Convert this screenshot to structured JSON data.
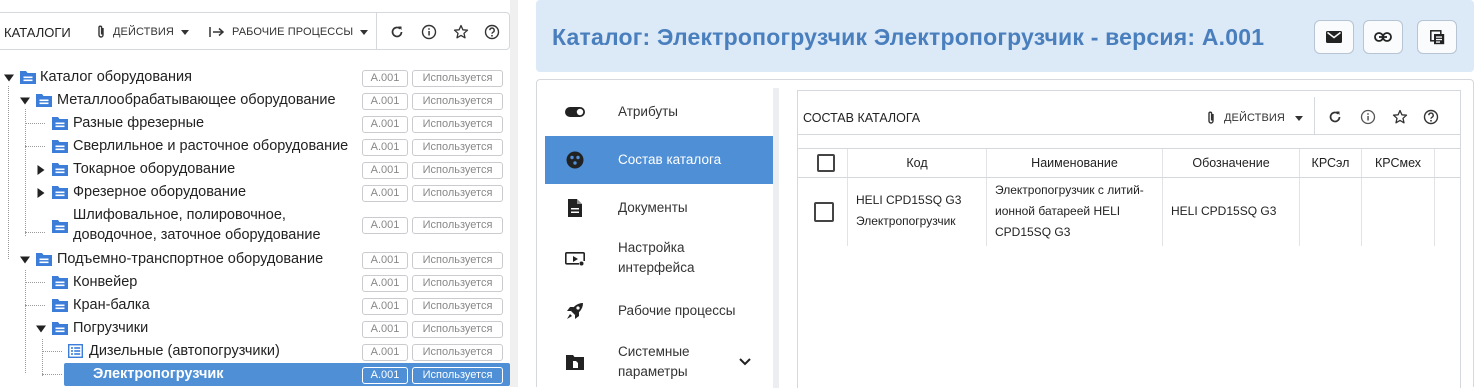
{
  "left_toolbar": {
    "title": "КАТАЛОГИ",
    "actions_label": "ДЕЙСТВИЯ",
    "workflows_label": "РАБОЧИЕ ПРОЦЕССЫ",
    "icons": [
      "paperclip-icon",
      "arrow-right-bar-icon",
      "refresh-icon",
      "info-icon",
      "star-icon",
      "help-icon"
    ]
  },
  "tree": {
    "items": [
      {
        "label": "Каталог оборудования",
        "version": "A.001",
        "status": "Используется",
        "expanded": true,
        "icon": "folder-icon"
      },
      {
        "label": "Металлообрабатывающее оборудование",
        "version": "A.001",
        "status": "Используется",
        "expanded": true,
        "icon": "folder-icon"
      },
      {
        "label": "Разные фрезерные",
        "version": "A.001",
        "status": "Используется",
        "icon": "folder-icon"
      },
      {
        "label": "Сверлильное и расточное оборудование",
        "version": "A.001",
        "status": "Используется",
        "icon": "folder-icon"
      },
      {
        "label": "Токарное оборудование",
        "version": "A.001",
        "status": "Используется",
        "expanded": false,
        "icon": "folder-icon"
      },
      {
        "label": "Фрезерное оборудование",
        "version": "A.001",
        "status": "Используется",
        "expanded": false,
        "icon": "folder-icon"
      },
      {
        "label": "Шлифовальное, полировочное, доводочное, заточное оборудование",
        "version": "A.001",
        "status": "Используется",
        "icon": "folder-icon"
      },
      {
        "label": "Подъемно-транспортное оборудование",
        "version": "A.001",
        "status": "Используется",
        "expanded": true,
        "icon": "folder-icon"
      },
      {
        "label": "Конвейер",
        "version": "A.001",
        "status": "Используется",
        "icon": "folder-icon"
      },
      {
        "label": "Кран-балка",
        "version": "A.001",
        "status": "Используется",
        "icon": "folder-icon"
      },
      {
        "label": "Погрузчики",
        "version": "A.001",
        "status": "Используется",
        "expanded": true,
        "icon": "folder-icon"
      },
      {
        "label": "Дизельные (автопогрузчики)",
        "version": "A.001",
        "status": "Используется",
        "icon": "list-table-icon"
      },
      {
        "label": "Электропогрузчик",
        "version": "A.001",
        "status": "Используется",
        "selected": true
      }
    ]
  },
  "header": {
    "title": "Каталог: Электропогрузчик Электропогрузчик - версия: A.001",
    "buttons": [
      "email-icon",
      "link-icon",
      "copy-icon"
    ]
  },
  "nav": {
    "items": [
      {
        "label": "Атрибуты",
        "icon": "toggle-icon"
      },
      {
        "label": "Состав каталога",
        "icon": "cluster-icon",
        "active": true
      },
      {
        "label": "Документы",
        "icon": "document-icon"
      },
      {
        "label": "Настройка интерфейса",
        "icon": "interface-settings-icon"
      },
      {
        "label": "Рабочие процессы",
        "icon": "rocket-icon"
      },
      {
        "label": "Системные параметры",
        "icon": "system-folder-icon"
      }
    ]
  },
  "content": {
    "title": "СОСТАВ КАТАЛОГА",
    "actions_label": "ДЕЙСТВИЯ",
    "columns": [
      "Код",
      "Наименование",
      "Обозначение",
      "КРСэл",
      "КРСмех"
    ],
    "rows": [
      {
        "code": "HELI CPD15SQ G3 Электропогрузчик",
        "name": "Электропогрузчик с литий-ионной батареей HELI CPD15SQ G3",
        "designation": "HELI CPD15SQ G3",
        "krsel": "",
        "krsmeh": ""
      }
    ]
  },
  "colors": {
    "accent": "#4f8fd6",
    "header_bg": "#dce9f7",
    "title_color": "#4a7fbe",
    "folder": "#3b7dd8"
  }
}
